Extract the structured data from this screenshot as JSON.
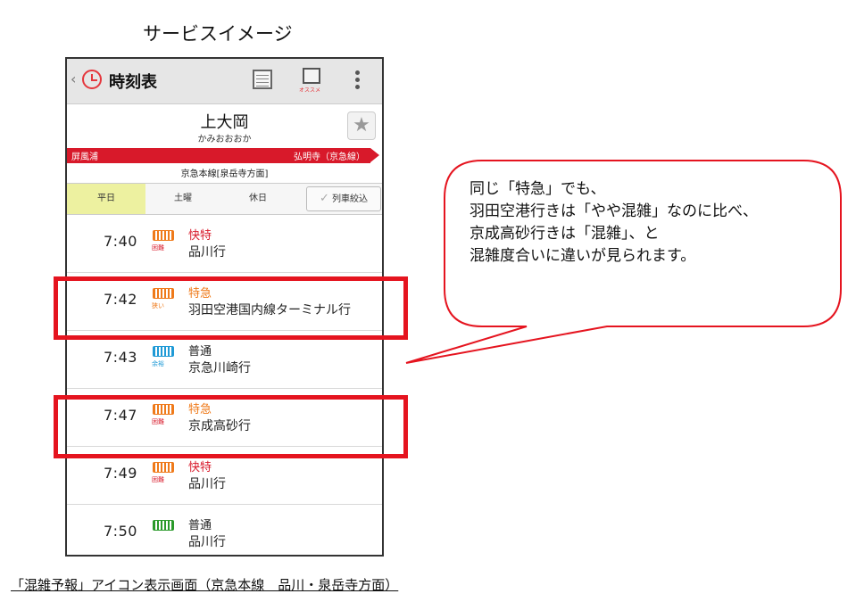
{
  "page_title": "サービスイメージ",
  "app": {
    "title": "時刻表",
    "osusume_label": "オススメ"
  },
  "station": {
    "name": "上大岡",
    "kana": "かみおおおか"
  },
  "direction": {
    "left": "屏風浦",
    "right": "弘明寺（京急線）",
    "line": "京急本線[泉岳寺方面]"
  },
  "tabs": [
    {
      "label": "平日",
      "selected": true
    },
    {
      "label": "土曜",
      "selected": false
    },
    {
      "label": "休日",
      "selected": false
    }
  ],
  "filter_button": "列車絞込",
  "departures": [
    {
      "time": "7:40",
      "type": "快特",
      "dest": "品川行",
      "congestion": "困難",
      "type_color": "#d8192a",
      "icon_color": "#ef7a1a"
    },
    {
      "time": "7:42",
      "type": "特急",
      "dest": "羽田空港国内線ターミナル行",
      "congestion": "狭い",
      "type_color": "#ef7a1a",
      "icon_color": "#ef7a1a"
    },
    {
      "time": "7:43",
      "type": "普通",
      "dest": "京急川崎行",
      "congestion": "余裕",
      "type_color": "#222222",
      "icon_color": "#1f9ad6"
    },
    {
      "time": "7:47",
      "type": "特急",
      "dest": "京成高砂行",
      "congestion": "困難",
      "type_color": "#ef7a1a",
      "icon_color": "#ef7a1a"
    },
    {
      "time": "7:49",
      "type": "快特",
      "dest": "品川行",
      "congestion": "困難",
      "type_color": "#d8192a",
      "icon_color": "#ef7a1a"
    },
    {
      "time": "7:50",
      "type": "普通",
      "dest": "品川行",
      "congestion": "",
      "type_color": "#222222",
      "icon_color": "#2a9a2a"
    }
  ],
  "callout": {
    "lines": [
      "同じ「特急」でも、",
      "羽田空港行きは「やや混雑」なのに比べ、",
      "京成高砂行きは「混雑」、と",
      "混雑度合いに違いが見られます。"
    ]
  },
  "caption": "「混雑予報」アイコン表示画面（京急本線　品川・泉岳寺方面）"
}
